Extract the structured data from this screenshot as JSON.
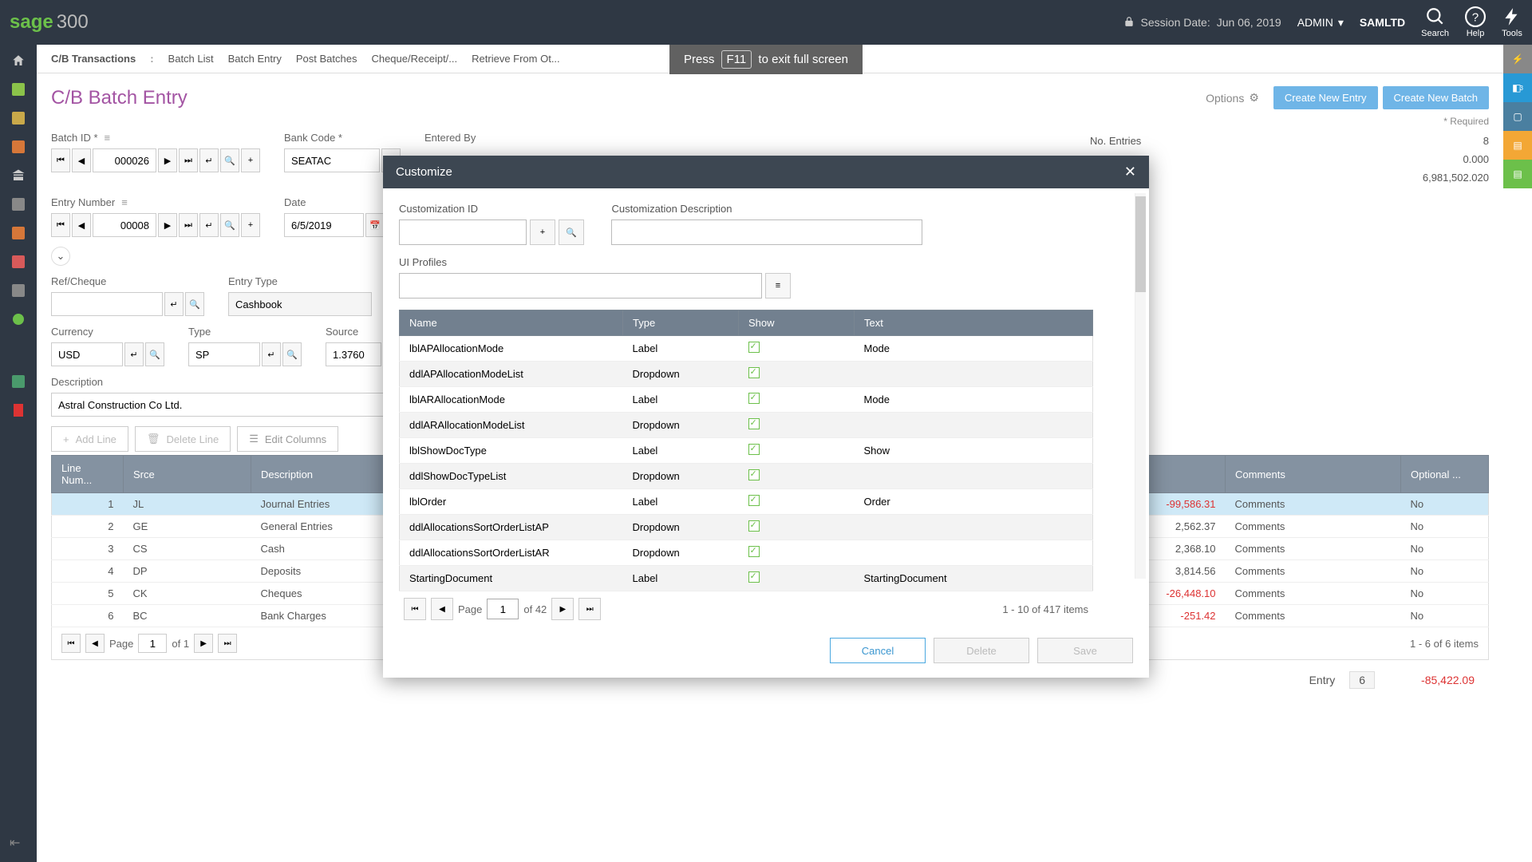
{
  "topbar": {
    "logo_sage": "sage",
    "logo_300": "300",
    "session_label": "Session Date:",
    "session_date": "Jun 06, 2019",
    "user": "ADMIN",
    "company": "SAMLTD",
    "search_label": "Search",
    "help_label": "Help",
    "tools_label": "Tools"
  },
  "exitfs": {
    "press": "Press",
    "key": "F11",
    "rest": "to exit full screen"
  },
  "breadcrumb": {
    "root": "C/B Transactions",
    "items": [
      "Batch List",
      "Batch Entry",
      "Post Batches",
      "Cheque/Receipt/...",
      "Retrieve From Ot..."
    ]
  },
  "page": {
    "title": "C/B Batch Entry",
    "options": "Options",
    "create_entry": "Create New Entry",
    "create_batch": "Create New Batch",
    "required": "* Required"
  },
  "form": {
    "batch_id_label": "Batch ID *",
    "batch_id": "000026",
    "bank_code_label": "Bank Code *",
    "bank_code": "SEATAC",
    "entered_by_label": "Entered By",
    "no_entries_label": "No. Entries",
    "no_entries": "8",
    "entry_number_label": "Entry Number",
    "entry_number": "00008",
    "date_label": "Date",
    "date": "6/5/2019",
    "zero_row": "0.000",
    "total_row": "6,981,502.020",
    "ref_cheque_label": "Ref/Cheque",
    "entry_type_label": "Entry Type",
    "entry_type": "Cashbook",
    "currency_label": "Currency",
    "currency": "USD",
    "type_label": "Type",
    "type": "SP",
    "source_label": "Source",
    "source": "1.3760",
    "description_label": "Description",
    "description": "Astral Construction Co Ltd."
  },
  "lines": {
    "add": "Add Line",
    "del": "Delete Line",
    "editcols": "Edit Columns",
    "headers": {
      "num": "Line Num...",
      "srce": "Srce",
      "desc": "Description",
      "amt": "",
      "comments": "Comments",
      "opt": "Optional ..."
    },
    "rows": [
      {
        "n": "1",
        "s": "JL",
        "d": "Journal Entries",
        "a": "-99,586.31",
        "neg": true,
        "c": "Comments",
        "o": "No"
      },
      {
        "n": "2",
        "s": "GE",
        "d": "General Entries",
        "a": "2,562.37",
        "neg": false,
        "c": "Comments",
        "o": "No"
      },
      {
        "n": "3",
        "s": "CS",
        "d": "Cash",
        "a": "2,368.10",
        "neg": false,
        "c": "Comments",
        "o": "No"
      },
      {
        "n": "4",
        "s": "DP",
        "d": "Deposits",
        "a": "3,814.56",
        "neg": false,
        "c": "Comments",
        "o": "No"
      },
      {
        "n": "5",
        "s": "CK",
        "d": "Cheques",
        "a": "-26,448.10",
        "neg": true,
        "c": "Comments",
        "o": "No"
      },
      {
        "n": "6",
        "s": "BC",
        "d": "Bank Charges",
        "a": "-251.42",
        "neg": true,
        "c": "Comments",
        "o": "No"
      }
    ],
    "pager": {
      "page": "Page",
      "num": "1",
      "of": "of 1",
      "range": "1 - 6 of 6 items"
    }
  },
  "footer": {
    "entry_label": "Entry",
    "entry_num": "6",
    "amount": "-85,422.09"
  },
  "modal": {
    "title": "Customize",
    "cust_id_label": "Customization ID",
    "cust_desc_label": "Customization Description",
    "ui_profiles_label": "UI Profiles",
    "cols": {
      "name": "Name",
      "type": "Type",
      "show": "Show",
      "text": "Text"
    },
    "rows": [
      {
        "name": "lblAPAllocationMode",
        "type": "Label",
        "text": "Mode"
      },
      {
        "name": "ddlAPAllocationModeList",
        "type": "Dropdown",
        "text": ""
      },
      {
        "name": "lblARAllocationMode",
        "type": "Label",
        "text": "Mode"
      },
      {
        "name": "ddlARAllocationModeList",
        "type": "Dropdown",
        "text": ""
      },
      {
        "name": "lblShowDocType",
        "type": "Label",
        "text": "Show"
      },
      {
        "name": "ddlShowDocTypeList",
        "type": "Dropdown",
        "text": ""
      },
      {
        "name": "lblOrder",
        "type": "Label",
        "text": "Order"
      },
      {
        "name": "ddlAllocationsSortOrderListAP",
        "type": "Dropdown",
        "text": ""
      },
      {
        "name": "ddlAllocationsSortOrderListAR",
        "type": "Dropdown",
        "text": ""
      },
      {
        "name": "StartingDocument",
        "type": "Label",
        "text": "StartingDocument"
      }
    ],
    "pager": {
      "page": "Page",
      "num": "1",
      "of": "of 42",
      "range": "1 - 10 of 417 items"
    },
    "cancel": "Cancel",
    "delete": "Delete",
    "save": "Save"
  }
}
